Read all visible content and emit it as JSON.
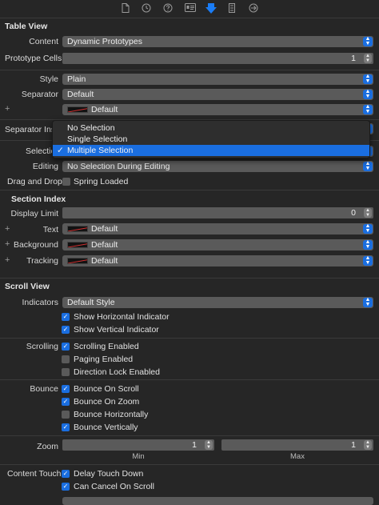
{
  "toolbar": {
    "icons": [
      "file-icon",
      "history-icon",
      "help-icon",
      "identity-icon",
      "attributes-icon",
      "size-icon",
      "connections-icon"
    ]
  },
  "table_view": {
    "title": "Table View",
    "content_label": "Content",
    "content_value": "Dynamic Prototypes",
    "prototype_cells_label": "Prototype Cells",
    "prototype_cells_value": "1",
    "style_label": "Style",
    "style_value": "Plain",
    "separator_label": "Separator",
    "separator_value": "Default",
    "separator_color_value": "Default",
    "separator_inset_label": "Separator Ins",
    "selection_label": "Selectio",
    "editing_label": "Editing",
    "editing_value": "No Selection During Editing",
    "drag_drop_label": "Drag and Drop",
    "spring_loaded_label": "Spring Loaded"
  },
  "selection_menu": {
    "items": [
      "No Selection",
      "Single Selection",
      "Multiple Selection"
    ],
    "selected_index": 2,
    "check": "✓"
  },
  "section_index": {
    "title": "Section Index",
    "display_limit_label": "Display Limit",
    "display_limit_value": "0",
    "text_label": "Text",
    "text_value": "Default",
    "background_label": "Background",
    "background_value": "Default",
    "tracking_label": "Tracking",
    "tracking_value": "Default"
  },
  "scroll_view": {
    "title": "Scroll View",
    "indicators_label": "Indicators",
    "indicators_value": "Default Style",
    "show_horizontal": "Show Horizontal Indicator",
    "show_vertical": "Show Vertical Indicator",
    "scrolling_label": "Scrolling",
    "scrolling_enabled": "Scrolling Enabled",
    "paging_enabled": "Paging Enabled",
    "direction_lock": "Direction Lock Enabled",
    "bounce_label": "Bounce",
    "bounce_on_scroll": "Bounce On Scroll",
    "bounce_on_zoom": "Bounce On Zoom",
    "bounce_horizontally": "Bounce Horizontally",
    "bounce_vertically": "Bounce Vertically",
    "zoom_label": "Zoom",
    "zoom_min_value": "1",
    "zoom_max_value": "1",
    "zoom_min_label": "Min",
    "zoom_max_label": "Max",
    "content_touch_label": "Content Touch",
    "delay_touch_down": "Delay Touch Down",
    "can_cancel_on_scroll": "Can Cancel On Scroll"
  },
  "glyphs": {
    "plus": "+",
    "check": "✓",
    "chevron_up": "▲",
    "chevron_down": "▼"
  },
  "colors": {
    "accent": "#1a6ee0",
    "background": "#262626",
    "control": "#5a5a5a"
  }
}
